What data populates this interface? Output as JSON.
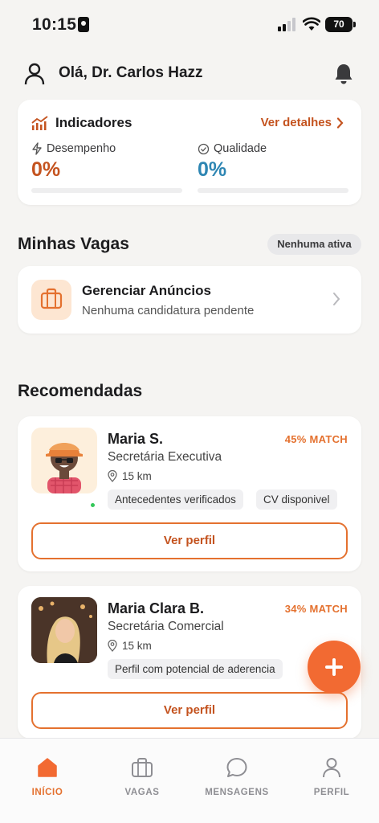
{
  "status_bar": {
    "time": "10:15",
    "battery": "70"
  },
  "header": {
    "greeting": "Olá, Dr. Carlos Hazz"
  },
  "indicators": {
    "title": "Indicadores",
    "details_link": "Ver detalhes",
    "metrics": [
      {
        "label": "Desempenho",
        "value": "0%",
        "progress": 0,
        "color": "#c4531f"
      },
      {
        "label": "Qualidade",
        "value": "0%",
        "progress": 0,
        "color": "#2e86b3"
      }
    ]
  },
  "minhas_vagas": {
    "title": "Minhas Vagas",
    "badge": "Nenhuma ativa",
    "card_title": "Gerenciar Anúncios",
    "card_subtitle": "Nenhuma candidatura pendente"
  },
  "recommendations": {
    "title": "Recomendadas",
    "items": [
      {
        "name": "Maria S.",
        "match": "45% MATCH",
        "role": "Secretária Executiva",
        "distance": "15 km",
        "tags": [
          "Antecedentes verificados",
          "CV disponivel"
        ],
        "button": "Ver perfil",
        "online": true
      },
      {
        "name": "Maria Clara B.",
        "match": "34% MATCH",
        "role": "Secretária Comercial",
        "distance": "15 km",
        "tags": [
          "Perfil com potencial de aderencia"
        ],
        "button": "Ver perfil",
        "online": false
      }
    ]
  },
  "bottom_nav": [
    {
      "label": "INÍCIO",
      "icon": "home-icon",
      "active": true
    },
    {
      "label": "VAGAS",
      "icon": "briefcase-icon",
      "active": false
    },
    {
      "label": "MENSAGENS",
      "icon": "chat-icon",
      "active": false
    },
    {
      "label": "PERFIL",
      "icon": "user-icon",
      "active": false
    }
  ],
  "colors": {
    "accent": "#e4712f",
    "accent_dark": "#c4531f",
    "quality": "#2e86b3",
    "background": "#f5f4f2"
  }
}
